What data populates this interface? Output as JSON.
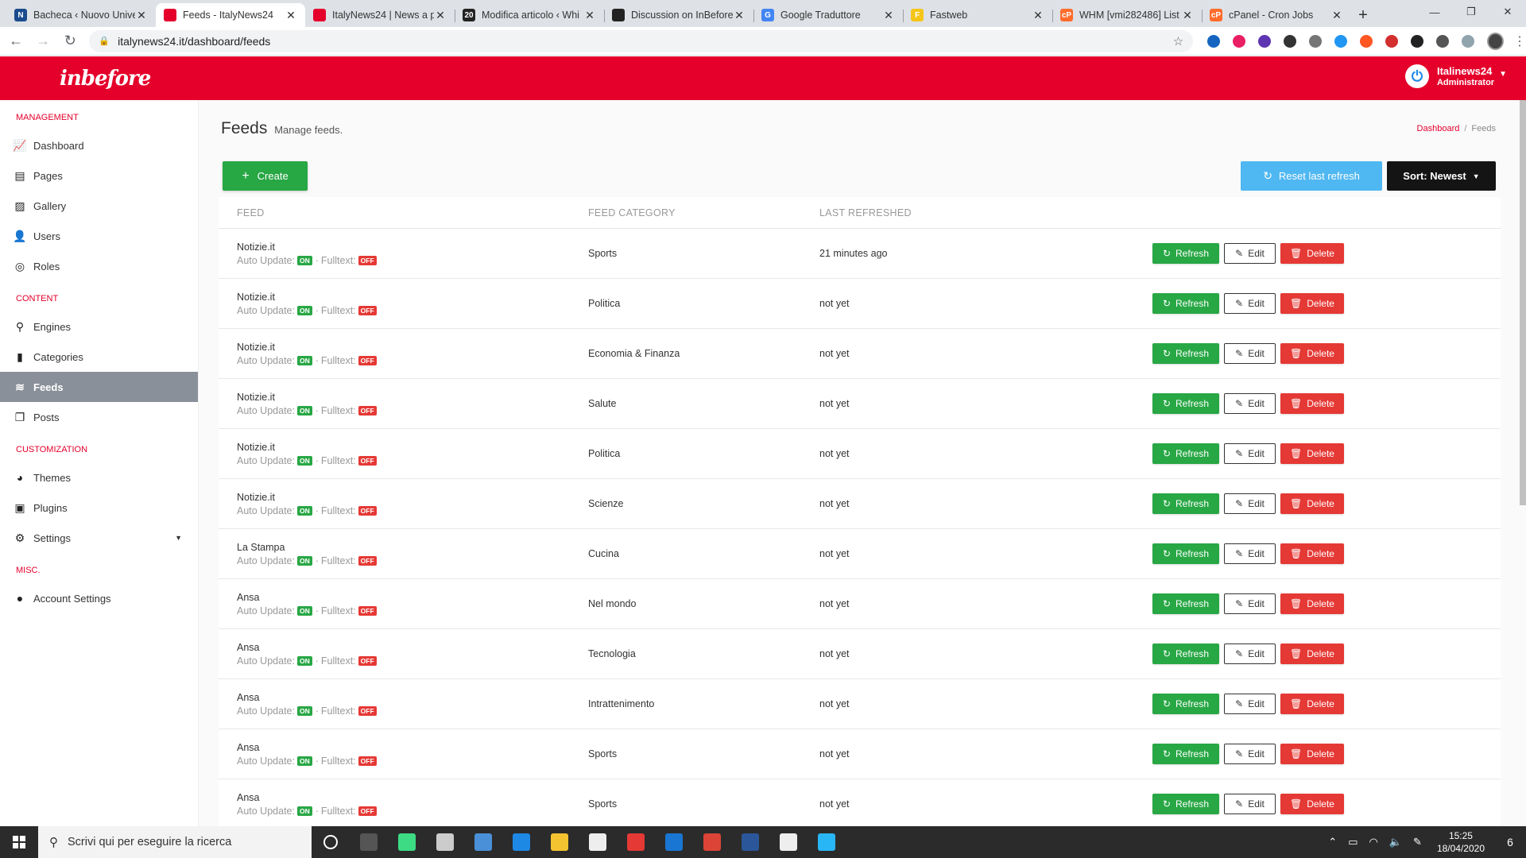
{
  "browser": {
    "tabs": [
      {
        "title": "Bacheca ‹ Nuovo Unive",
        "color": "#1a4b8c",
        "glyph": "N",
        "active": false
      },
      {
        "title": "Feeds - ItalyNews24",
        "color": "#e4002b",
        "glyph": "",
        "active": true
      },
      {
        "title": "ItalyNews24 | News a p",
        "color": "#e4002b",
        "glyph": "",
        "active": false
      },
      {
        "title": "Modifica articolo ‹ Whi",
        "color": "#222222",
        "glyph": "20",
        "active": false
      },
      {
        "title": "Discussion on InBefore",
        "color": "#222222",
        "glyph": "",
        "active": false
      },
      {
        "title": "Google Traduttore",
        "color": "#4285f4",
        "glyph": "G",
        "active": false
      },
      {
        "title": "Fastweb",
        "color": "#f5c518",
        "glyph": "F",
        "active": false
      },
      {
        "title": "WHM [vmi282486] List",
        "color": "#ff6c2c",
        "glyph": "cP",
        "active": false
      },
      {
        "title": "cPanel - Cron Jobs",
        "color": "#ff6c2c",
        "glyph": "cP",
        "active": false
      }
    ],
    "url": "italynews24.it/dashboard/feeds",
    "extension_colors": [
      "#1565c0",
      "#e91e63",
      "#5e35b1",
      "#333333",
      "#757575",
      "#2196f3",
      "#ff5722",
      "#d32f2f",
      "#222222",
      "#555555",
      "#90a4ae"
    ]
  },
  "app": {
    "logo": "inbefore",
    "user": {
      "name": "Italinews24",
      "role": "Administrator"
    }
  },
  "sidebar": {
    "sections": [
      {
        "title": "Management",
        "items": [
          {
            "label": "Dashboard",
            "icon": "chart-icon",
            "glyph": "📈",
            "active": false
          },
          {
            "label": "Pages",
            "icon": "pages-icon",
            "glyph": "▤",
            "active": false
          },
          {
            "label": "Gallery",
            "icon": "image-icon",
            "glyph": "▨",
            "active": false
          },
          {
            "label": "Users",
            "icon": "user-icon",
            "glyph": "👤",
            "active": false
          },
          {
            "label": "Roles",
            "icon": "fingerprint-icon",
            "glyph": "◎",
            "active": false
          }
        ]
      },
      {
        "title": "Content",
        "items": [
          {
            "label": "Engines",
            "icon": "search-icon",
            "glyph": "⚲",
            "active": false
          },
          {
            "label": "Categories",
            "icon": "bookmark-icon",
            "glyph": "▮",
            "active": false
          },
          {
            "label": "Feeds",
            "icon": "rss-icon",
            "glyph": "≋",
            "active": true
          },
          {
            "label": "Posts",
            "icon": "copy-icon",
            "glyph": "❐",
            "active": false
          }
        ]
      },
      {
        "title": "Customization",
        "items": [
          {
            "label": "Themes",
            "icon": "palette-icon",
            "glyph": "◕",
            "active": false
          },
          {
            "label": "Plugins",
            "icon": "plug-icon",
            "glyph": "▣",
            "active": false
          },
          {
            "label": "Settings",
            "icon": "gear-icon",
            "glyph": "⚙",
            "active": false,
            "dropdown": true
          }
        ]
      },
      {
        "title": "Misc.",
        "items": [
          {
            "label": "Account Settings",
            "icon": "account-icon",
            "glyph": "●",
            "active": false
          }
        ]
      }
    ]
  },
  "page": {
    "title": "Feeds",
    "subtitle": "Manage feeds.",
    "breadcrumb": {
      "home": "Dashboard",
      "separator": "/",
      "current": "Feeds"
    },
    "create_label": "Create",
    "reset_label": "Reset last refresh",
    "sort_label": "Sort: Newest"
  },
  "table": {
    "headers": {
      "feed": "Feed",
      "category": "Feed Category",
      "last": "Last Refreshed"
    },
    "auto_label": "Auto Update:",
    "fulltext_label": "Fulltext:",
    "on_label": "ON",
    "off_label": "OFF",
    "actions": {
      "refresh": "Refresh",
      "edit": "Edit",
      "delete": "Delete"
    },
    "rows": [
      {
        "name": "Notizie.it",
        "category": "Sports",
        "last": "21 minutes ago",
        "auto": "ON",
        "fulltext": "OFF"
      },
      {
        "name": "Notizie.it",
        "category": "Politica",
        "last": "not yet",
        "auto": "ON",
        "fulltext": "OFF"
      },
      {
        "name": "Notizie.it",
        "category": "Economia & Finanza",
        "last": "not yet",
        "auto": "ON",
        "fulltext": "OFF"
      },
      {
        "name": "Notizie.it",
        "category": "Salute",
        "last": "not yet",
        "auto": "ON",
        "fulltext": "OFF"
      },
      {
        "name": "Notizie.it",
        "category": "Politica",
        "last": "not yet",
        "auto": "ON",
        "fulltext": "OFF"
      },
      {
        "name": "Notizie.it",
        "category": "Scienze",
        "last": "not yet",
        "auto": "ON",
        "fulltext": "OFF"
      },
      {
        "name": "La Stampa",
        "category": "Cucina",
        "last": "not yet",
        "auto": "ON",
        "fulltext": "OFF"
      },
      {
        "name": "Ansa",
        "category": "Nel mondo",
        "last": "not yet",
        "auto": "ON",
        "fulltext": "OFF"
      },
      {
        "name": "Ansa",
        "category": "Tecnologia",
        "last": "not yet",
        "auto": "ON",
        "fulltext": "OFF"
      },
      {
        "name": "Ansa",
        "category": "Intrattenimento",
        "last": "not yet",
        "auto": "ON",
        "fulltext": "OFF"
      },
      {
        "name": "Ansa",
        "category": "Sports",
        "last": "not yet",
        "auto": "ON",
        "fulltext": "OFF"
      },
      {
        "name": "Ansa",
        "category": "Sports",
        "last": "not yet",
        "auto": "ON",
        "fulltext": "OFF"
      }
    ]
  },
  "taskbar": {
    "search_placeholder": "Scrivi qui per eseguire la ricerca",
    "apps": [
      {
        "name": "cortana",
        "color": "#2b2b2b"
      },
      {
        "name": "task-view",
        "color": "#555555"
      },
      {
        "name": "android-studio",
        "color": "#3ddc84"
      },
      {
        "name": "app-cloud",
        "color": "#cccccc"
      },
      {
        "name": "app-photo",
        "color": "#4a90d9"
      },
      {
        "name": "edge",
        "color": "#1e88e5"
      },
      {
        "name": "file-explorer",
        "color": "#f4c430"
      },
      {
        "name": "store",
        "color": "#eeeeee"
      },
      {
        "name": "app-gift",
        "color": "#e53935"
      },
      {
        "name": "mail",
        "color": "#1976d2"
      },
      {
        "name": "chrome",
        "color": "#db4437"
      },
      {
        "name": "word",
        "color": "#2b579a"
      },
      {
        "name": "app-notes",
        "color": "#eeeeee"
      },
      {
        "name": "app-blue",
        "color": "#29b6f6"
      }
    ],
    "time": "15:25",
    "date": "18/04/2020",
    "notifications": "6"
  }
}
